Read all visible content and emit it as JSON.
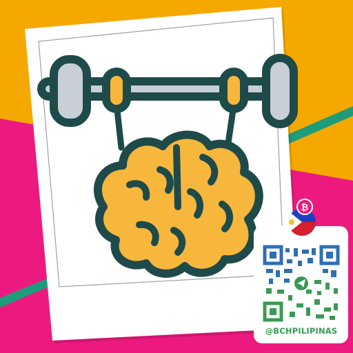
{
  "colors": {
    "background_orange": "#f5a800",
    "background_magenta": "#ec1a7f",
    "stripe_teal": "#1f9b7a",
    "frame_white": "#ffffff",
    "outline_dark": "#1f4a4a",
    "brain_fill": "#f6b73c",
    "weight_plate_gray": "#c9cfd6",
    "handle_green": "#2e9e6a",
    "qr_module_blue": "#2f6fb3",
    "qr_module_green": "#3a9a55",
    "flag_blue": "#1d3fbf",
    "flag_red": "#d22030",
    "flag_sun_yellow": "#f2c230"
  },
  "icons": {
    "illustration": "brain-lifting-barbell-icon",
    "flag": "philippines-flag-icon",
    "badge": "bitcoin-cash-badge-icon",
    "qr_center": "telegram-icon"
  },
  "qr_card": {
    "handle": "@BCHPILIPINAS"
  }
}
